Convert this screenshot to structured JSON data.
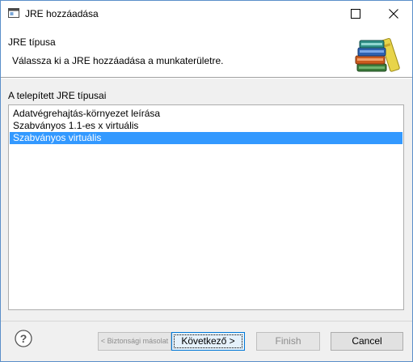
{
  "window": {
    "title": "JRE hozzáadása"
  },
  "banner": {
    "title": "JRE típusa",
    "description": "Válassza ki a JRE hozzáadása a munkaterületre."
  },
  "list": {
    "label": "A telepített JRE típusai",
    "items": [
      {
        "label": "Adatvégrehajtás-környezet leírása",
        "selected": false
      },
      {
        "label": "Szabványos 1.1-es x virtuális",
        "selected": false
      },
      {
        "label": "Szabványos virtuális",
        "selected": true
      }
    ]
  },
  "buttons": {
    "back": "< Biztonsági másolat",
    "next": "Következő >",
    "finish": "Finish",
    "cancel": "Cancel"
  },
  "icons": {
    "app": "window-app-icon",
    "maximize": "maximize-icon",
    "close": "close-icon",
    "banner": "books-icon",
    "help": "help-icon"
  },
  "colors": {
    "selection": "#3399ff",
    "default_button_border": "#0078d7"
  }
}
